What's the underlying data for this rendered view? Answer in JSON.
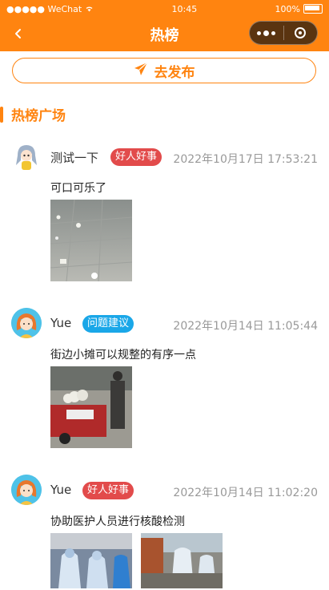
{
  "status_bar": {
    "carrier": "●●●●● WeChat",
    "time": "10:45",
    "battery": "100%"
  },
  "nav": {
    "title": "热榜"
  },
  "publish_label": "去发布",
  "section_title": "热榜广场",
  "posts": [
    {
      "user": "测试一下",
      "tag": "好人好事",
      "time": "2022年10月17日 17:53:21",
      "content": "可口可乐了"
    },
    {
      "user": "Yue",
      "tag": "问题建议",
      "time": "2022年10月14日 11:05:44",
      "content": "街边小摊可以规整的有序一点"
    },
    {
      "user": "Yue",
      "tag": "好人好事",
      "time": "2022年10月14日 11:02:20",
      "content": "协助医护人员进行核酸检测"
    }
  ],
  "colors": {
    "brand": "#ff8410",
    "tag_red": "#e24b4b",
    "tag_blue": "#1aa7e8",
    "capsule": "#5a3410"
  }
}
